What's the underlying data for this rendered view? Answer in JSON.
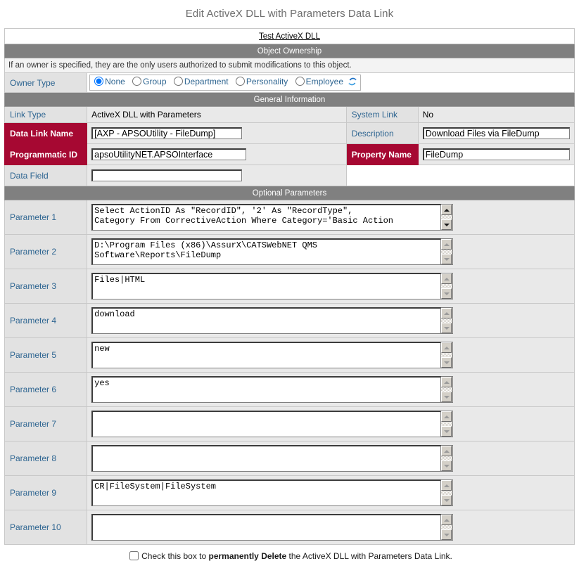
{
  "page": {
    "title": "Edit ActiveX DLL with Parameters Data Link",
    "object_link": "Test ActiveX DLL"
  },
  "colors": {
    "section_bar": "#808080",
    "required_label": "#a60832",
    "label_text": "#2e6591",
    "label_bg": "#e2e2e2",
    "title_text": "#6e6e6e"
  },
  "ownership": {
    "heading": "Object Ownership",
    "note": "If an owner is specified, they are the only users authorized to submit modifications to this object.",
    "owner_type_label": "Owner Type",
    "options": [
      {
        "label": "None",
        "selected": true
      },
      {
        "label": "Group",
        "selected": false
      },
      {
        "label": "Department",
        "selected": false
      },
      {
        "label": "Personality",
        "selected": false
      },
      {
        "label": "Employee",
        "selected": false
      }
    ],
    "refresh_icon": "refresh-icon"
  },
  "general": {
    "heading": "General Information",
    "link_type_label": "Link Type",
    "link_type_value": "ActiveX DLL with Parameters",
    "system_link_label": "System Link",
    "system_link_value": "No",
    "data_link_name_label": "Data Link Name",
    "data_link_name_value": "[AXP - APSOUtility - FileDump]",
    "description_label": "Description",
    "description_value": "Download Files via FileDump",
    "programmatic_id_label": "Programmatic ID",
    "programmatic_id_value": "apsoUtilityNET.APSOInterface",
    "property_name_label": "Property Name",
    "property_name_value": "FileDump",
    "data_field_label": "Data Field",
    "data_field_value": ""
  },
  "optional": {
    "heading": "Optional Parameters",
    "parameters": [
      {
        "label": "Parameter 1",
        "value": "Select ActionID As \"RecordID\", '2' As \"RecordType\",\nCategory From CorrectiveAction Where Category='Basic Action",
        "active": true
      },
      {
        "label": "Parameter 2",
        "value": "D:\\Program Files (x86)\\AssurX\\CATSWebNET QMS\nSoftware\\Reports\\FileDump",
        "active": false
      },
      {
        "label": "Parameter 3",
        "value": "Files|HTML",
        "active": false
      },
      {
        "label": "Parameter 4",
        "value": "download",
        "active": false
      },
      {
        "label": "Parameter 5",
        "value": "new",
        "active": false
      },
      {
        "label": "Parameter 6",
        "value": "yes",
        "active": false
      },
      {
        "label": "Parameter 7",
        "value": "",
        "active": false
      },
      {
        "label": "Parameter 8",
        "value": "",
        "active": false
      },
      {
        "label": "Parameter 9",
        "value": "CR|FileSystem|FileSystem",
        "active": false
      },
      {
        "label": "Parameter 10",
        "value": "",
        "active": false
      }
    ]
  },
  "delete": {
    "prefix": "Check this box to ",
    "emphasis": "permanently Delete",
    "suffix": " the ActiveX DLL with Parameters Data Link.",
    "checked": false
  }
}
